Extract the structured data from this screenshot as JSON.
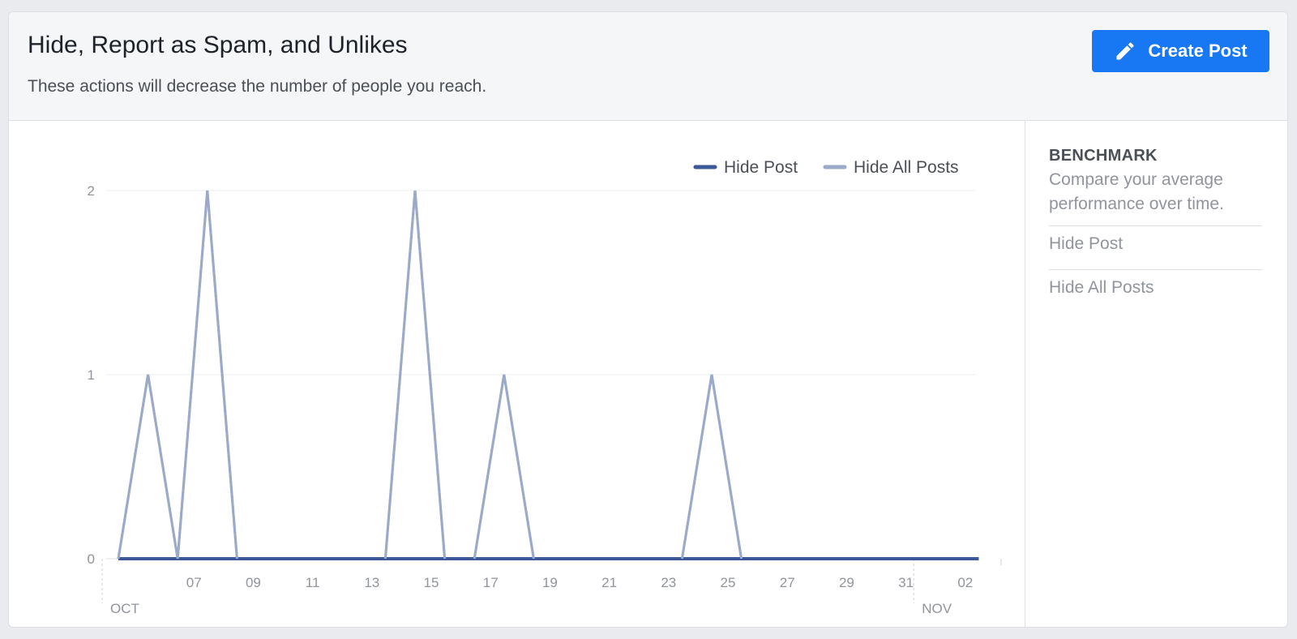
{
  "header": {
    "title": "Hide, Report as Spam, and Unlikes",
    "subtitle": "These actions will decrease the number of people you reach.",
    "create_post_label": "Create Post",
    "create_post_icon": "pencil-icon"
  },
  "benchmark": {
    "title": "BENCHMARK",
    "description": "Compare your average performance over time.",
    "items": [
      {
        "label": "Hide Post"
      },
      {
        "label": "Hide All Posts"
      }
    ]
  },
  "colors": {
    "accent": "#1877f2",
    "hide_post": "#3b5998",
    "hide_all_posts": "#9aaac8"
  },
  "chart_data": {
    "type": "line",
    "x": [
      "Oct 5",
      "Oct 6",
      "Oct 7",
      "Oct 8",
      "Oct 9",
      "Oct 10",
      "Oct 11",
      "Oct 12",
      "Oct 13",
      "Oct 14",
      "Oct 15",
      "Oct 16",
      "Oct 17",
      "Oct 18",
      "Oct 19",
      "Oct 20",
      "Oct 21",
      "Oct 22",
      "Oct 23",
      "Oct 24",
      "Oct 25",
      "Oct 26",
      "Oct 27",
      "Oct 28",
      "Oct 29",
      "Oct 30",
      "Oct 31",
      "Nov 1",
      "Nov 2",
      "Nov 3"
    ],
    "x_tick_labels": [
      "07",
      "09",
      "11",
      "13",
      "15",
      "17",
      "19",
      "21",
      "23",
      "25",
      "27",
      "29",
      "31",
      "02"
    ],
    "month_labels": [
      "OCT",
      "NOV"
    ],
    "y_ticks": [
      0,
      1,
      2
    ],
    "ylim": [
      0,
      2
    ],
    "legend": "top-right",
    "series": [
      {
        "name": "Hide Post",
        "color": "#3b5998",
        "values": [
          0,
          0,
          0,
          0,
          0,
          0,
          0,
          0,
          0,
          0,
          0,
          0,
          0,
          0,
          0,
          0,
          0,
          0,
          0,
          0,
          0,
          0,
          0,
          0,
          0,
          0,
          0,
          0,
          0,
          0
        ]
      },
      {
        "name": "Hide All Posts",
        "color": "#9aaac8",
        "values": [
          0,
          1,
          0,
          2,
          0,
          0,
          0,
          0,
          0,
          0,
          2,
          0,
          0,
          1,
          0,
          0,
          0,
          0,
          0,
          0,
          1,
          0,
          0,
          0,
          0,
          0,
          0,
          0,
          0,
          0
        ]
      }
    ]
  }
}
